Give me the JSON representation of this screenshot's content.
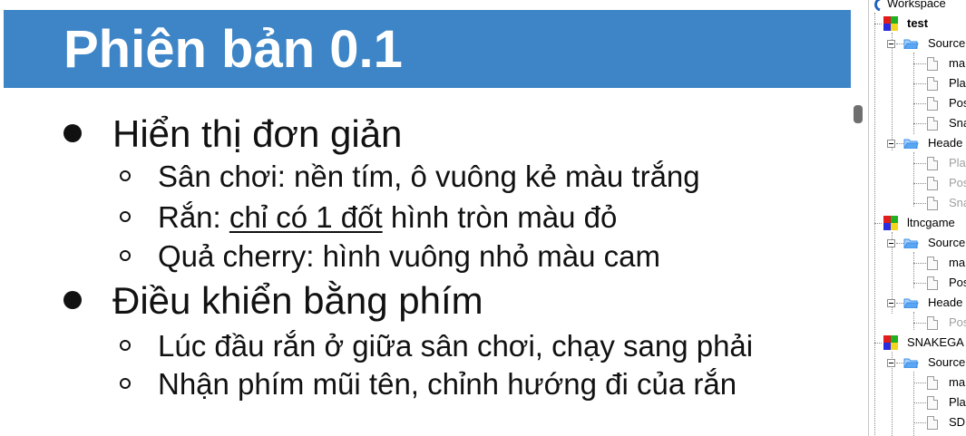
{
  "slide": {
    "title": "Phiên bản 0.1",
    "bullets": [
      {
        "text": "Hiển thị đơn giản",
        "sub": [
          {
            "text": "Sân chơi: nền tím, ô vuông kẻ màu trắng"
          },
          {
            "prefix": "Rắn: ",
            "underlined": "chỉ có 1 đốt",
            "suffix": " hình tròn màu đỏ"
          },
          {
            "text": "Quả cherry: hình vuông nhỏ màu cam"
          }
        ]
      },
      {
        "text": "Điều khiển bằng phím",
        "sub": [
          {
            "text": "Lúc đầu rắn ở giữa sân chơi, chạy sang phải"
          },
          {
            "text": "Nhận phím mũi tên, chỉnh hướng đi của rắn"
          }
        ]
      }
    ]
  },
  "tree": {
    "workspace": "Workspace",
    "items": [
      {
        "label": "test",
        "kind": "project",
        "bold": true
      },
      {
        "label": "Source",
        "kind": "folder"
      },
      {
        "label": "ma",
        "kind": "file"
      },
      {
        "label": "Pla",
        "kind": "file"
      },
      {
        "label": "Pos",
        "kind": "file"
      },
      {
        "label": "Sna",
        "kind": "file"
      },
      {
        "label": "Heade",
        "kind": "folder"
      },
      {
        "label": "Pla",
        "kind": "file",
        "dimmed": true
      },
      {
        "label": "Pos",
        "kind": "file",
        "dimmed": true
      },
      {
        "label": "Sna",
        "kind": "file",
        "dimmed": true
      },
      {
        "label": "ltncgame",
        "kind": "project"
      },
      {
        "label": "Source",
        "kind": "folder"
      },
      {
        "label": "ma",
        "kind": "file"
      },
      {
        "label": "Pos",
        "kind": "file"
      },
      {
        "label": "Heade",
        "kind": "folder"
      },
      {
        "label": "Pos",
        "kind": "file",
        "dimmed": true
      },
      {
        "label": "SNAKEGA",
        "kind": "project"
      },
      {
        "label": "Source",
        "kind": "folder"
      },
      {
        "label": "ma",
        "kind": "file"
      },
      {
        "label": "Pla",
        "kind": "file"
      },
      {
        "label": "SD",
        "kind": "file"
      }
    ]
  },
  "colors": {
    "title_bar": "#3d85c6",
    "folder": "#3a8ee6"
  }
}
